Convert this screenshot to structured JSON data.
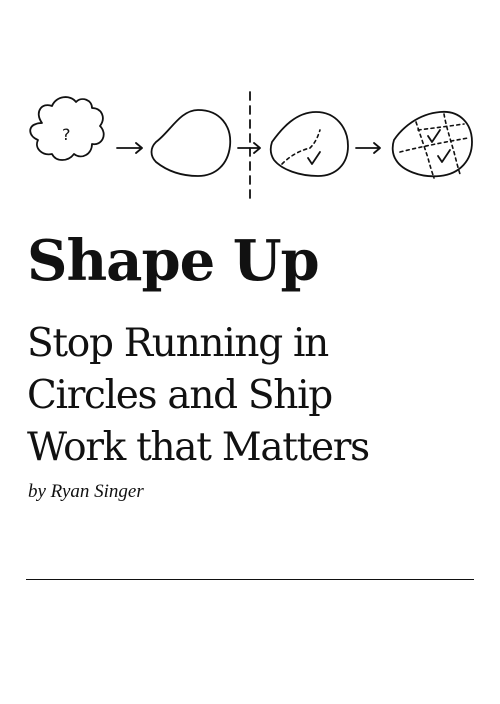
{
  "cover": {
    "title": "Shape Up",
    "subtitle_lines": [
      "Stop Running in",
      "Circles and Ship",
      "Work that Matters"
    ],
    "author": "by Ryan Singer"
  },
  "illustration": {
    "description_icons": [
      "cloud-question-icon",
      "arrow-right-icon",
      "blob-icon",
      "dashed-divider-icon",
      "blob-check-icon",
      "blob-scopes-check-icon"
    ],
    "question_glyph": "?"
  }
}
